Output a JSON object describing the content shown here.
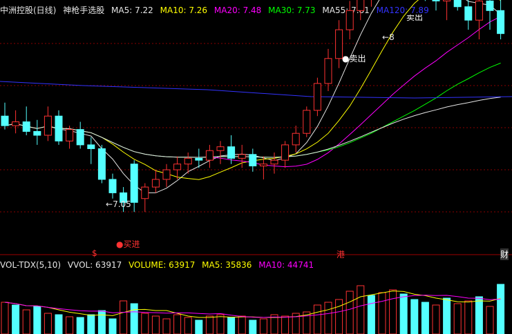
{
  "header": {
    "stock_name": "中洲控股(日线)",
    "indicator_name": "神枪手选股",
    "ma": [
      {
        "label": "MA5: 7.22",
        "color": "#e6e6e6"
      },
      {
        "label": "MA10: 7.26",
        "color": "#ffff00"
      },
      {
        "label": "MA20: 7.48",
        "color": "#ff00ff"
      },
      {
        "label": "MA30: 7.73",
        "color": "#00ff00"
      },
      {
        "label": "MA55: 7.81",
        "color": "#e6e6e6"
      },
      {
        "label": "MA120: 7.89",
        "color": "#3333ff"
      }
    ]
  },
  "annotations": {
    "low_price": "7.05",
    "high_price": "8",
    "buy_signal": "买进",
    "sell_signal_1": "卖出",
    "sell_signal_2": "卖出",
    "marker_left": "$",
    "marker_mid": "港",
    "marker_right": "财"
  },
  "volume_header": {
    "name": "VOL-TDX(5,10)",
    "vvol": "VVOL: 63917",
    "volume": "VOLUME: 63917",
    "ma5": "MA5: 35836",
    "ma10": "MA10: 44741"
  },
  "colors": {
    "up": "#ff3232",
    "down": "#54ffff",
    "ma5": "#e6e6e6",
    "ma10": "#ffff00",
    "ma20": "#ff00ff",
    "ma30": "#00ff00",
    "ma55": "#e6e6e6",
    "ma120": "#3333ff"
  },
  "chart_data": {
    "type": "candlestick",
    "candles": [
      [
        7.55,
        7.62,
        7.48,
        7.5
      ],
      [
        7.5,
        7.58,
        7.46,
        7.52
      ],
      [
        7.52,
        7.6,
        7.45,
        7.47
      ],
      [
        7.47,
        7.53,
        7.4,
        7.45
      ],
      [
        7.45,
        7.6,
        7.42,
        7.55
      ],
      [
        7.55,
        7.58,
        7.4,
        7.42
      ],
      [
        7.42,
        7.5,
        7.38,
        7.48
      ],
      [
        7.48,
        7.52,
        7.38,
        7.4
      ],
      [
        7.4,
        7.44,
        7.3,
        7.38
      ],
      [
        7.38,
        7.4,
        7.2,
        7.22
      ],
      [
        7.22,
        7.25,
        7.12,
        7.15
      ],
      [
        7.15,
        7.18,
        7.05,
        7.1
      ],
      [
        7.3,
        7.32,
        7.05,
        7.1
      ],
      [
        7.12,
        7.2,
        7.05,
        7.18
      ],
      [
        7.18,
        7.27,
        7.15,
        7.22
      ],
      [
        7.22,
        7.3,
        7.18,
        7.27
      ],
      [
        7.27,
        7.34,
        7.22,
        7.3
      ],
      [
        7.3,
        7.36,
        7.25,
        7.33
      ],
      [
        7.33,
        7.38,
        7.28,
        7.32
      ],
      [
        7.32,
        7.4,
        7.28,
        7.37
      ],
      [
        7.37,
        7.42,
        7.3,
        7.39
      ],
      [
        7.39,
        7.45,
        7.3,
        7.33
      ],
      [
        7.33,
        7.4,
        7.28,
        7.35
      ],
      [
        7.35,
        7.38,
        7.26,
        7.29
      ],
      [
        7.29,
        7.34,
        7.22,
        7.3
      ],
      [
        7.3,
        7.36,
        7.25,
        7.32
      ],
      [
        7.32,
        7.42,
        7.28,
        7.4
      ],
      [
        7.4,
        7.5,
        7.36,
        7.46
      ],
      [
        7.46,
        7.6,
        7.44,
        7.58
      ],
      [
        7.58,
        7.75,
        7.55,
        7.72
      ],
      [
        7.72,
        7.9,
        7.68,
        7.85
      ],
      [
        7.85,
        8.05,
        7.8,
        8.0
      ],
      [
        8.0,
        8.15,
        7.95,
        8.1
      ],
      [
        8.1,
        8.25,
        8.05,
        8.2
      ],
      [
        8.2,
        8.35,
        8.12,
        8.28
      ],
      [
        8.28,
        8.4,
        8.2,
        8.32
      ],
      [
        8.32,
        8.45,
        8.25,
        8.36
      ],
      [
        8.36,
        8.44,
        8.28,
        8.3
      ],
      [
        8.3,
        8.4,
        8.22,
        8.25
      ],
      [
        8.25,
        8.32,
        8.15,
        8.2
      ],
      [
        8.2,
        8.28,
        8.1,
        8.15
      ],
      [
        8.15,
        8.25,
        8.05,
        8.22
      ],
      [
        8.22,
        8.3,
        8.1,
        8.12
      ],
      [
        8.12,
        8.36,
        8.0,
        8.05
      ],
      [
        8.05,
        8.2,
        7.95,
        8.15
      ],
      [
        8.15,
        8.22,
        8.0,
        8.1
      ],
      [
        8.1,
        8.18,
        7.95,
        7.98
      ]
    ]
  }
}
